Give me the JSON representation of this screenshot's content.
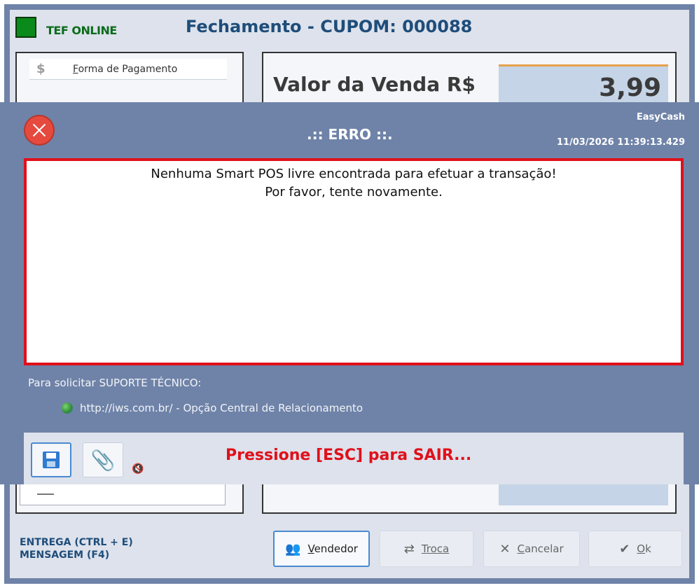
{
  "header": {
    "tef_status": "TEF ONLINE",
    "title": "Fechamento - CUPOM: 000088"
  },
  "left_panel": {
    "payment_icon": "dollar-icon",
    "payment_label_first": "F",
    "payment_label_rest": "orma de Pagamento"
  },
  "right_panel": {
    "sale_label": "Valor da Venda R$",
    "sale_value": "3,99"
  },
  "shortcuts": {
    "delivery": "ENTREGA (CTRL + E)",
    "message": "MENSAGEM (F4)"
  },
  "actions": {
    "vendedor_first": "V",
    "vendedor_rest": "endedor",
    "troca": "Troca",
    "cancelar_first": "C",
    "cancelar_rest": "ancelar",
    "ok_first": "O",
    "ok_rest": "k"
  },
  "modal": {
    "title": ".:: ERRO ::.",
    "brand": "EasyCash",
    "timestamp": "11/03/2026 11:39:13.429",
    "message_line1": "Nenhuma Smart POS livre encontrada para efetuar a transação!",
    "message_line2": "Por favor, tente novamente.",
    "support_label": "Para solicitar SUPORTE TÉCNICO:",
    "support_link": "http://iws.com.br/ - Opção Central de Relacionamento",
    "esc_text": "Pressione [ESC] para SAIR...",
    "colors": {
      "border": "#e0101a",
      "background": "#6f83a8"
    }
  }
}
